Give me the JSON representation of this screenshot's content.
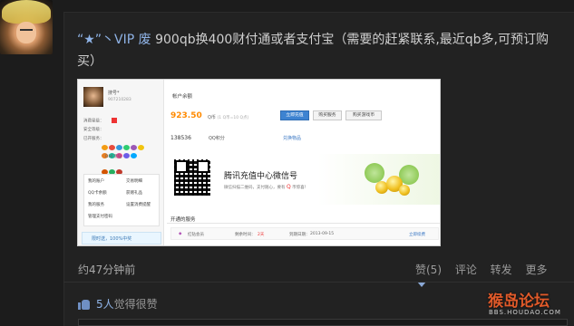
{
  "post": {
    "username": "“★”丶VIP 废",
    "text": "900qb换400财付通或者支付宝（需要的赶紧联系,最近qb多,可预订购买）",
    "time": "约47分钟前",
    "actions": {
      "like": "赞(5)",
      "comment": "评论",
      "repost": "转发",
      "more": "更多"
    },
    "likes": {
      "count": "5人",
      "label": "觉得很赞"
    }
  },
  "screenshot": {
    "profile": {
      "name": "搜号*",
      "id": "907210283",
      "stats": [
        "消费星级：",
        "安全等级：",
        "已开服务："
      ],
      "level_label": "DNF黑钻",
      "menu": [
        "我的账户",
        "QQ卡余额",
        "我的服务",
        "管理支付密码",
        "交易明细",
        "获赠礼品",
        "设置消费提醒"
      ],
      "promo": "限时送，100%中奖"
    },
    "account": {
      "title": "帐户余额",
      "balance": "923.50",
      "balance_unit": "Q币",
      "balance_note": "(1 Q币=10 Q点)",
      "buttons": [
        "立即充值",
        "购买服务",
        "购买游戏币"
      ],
      "points": "138536",
      "points_label": "QQ积分",
      "exchange": "兑换物品"
    },
    "banner": {
      "title": "腾讯充值中心微信号",
      "subtitle": "微信扫描二维码，支付随心，要有",
      "q_letter": "Q",
      "subtitle_end": "币惊喜！"
    },
    "services": {
      "title": "开通的服务",
      "row": {
        "name": "红钻会员",
        "remain": "剩余时间：",
        "days": "2天",
        "expire_label": "到期日期：",
        "expire": "2013-09-15",
        "action": "立即续费"
      }
    }
  },
  "watermark": {
    "brand": "猴岛论坛",
    "url": "BBS.HOUDAO.COM"
  },
  "colors": {
    "background": "#1c1c1c",
    "username": "#8fb3e6",
    "accent_orange": "#ff8a00",
    "watermark": "#e05a2a"
  }
}
